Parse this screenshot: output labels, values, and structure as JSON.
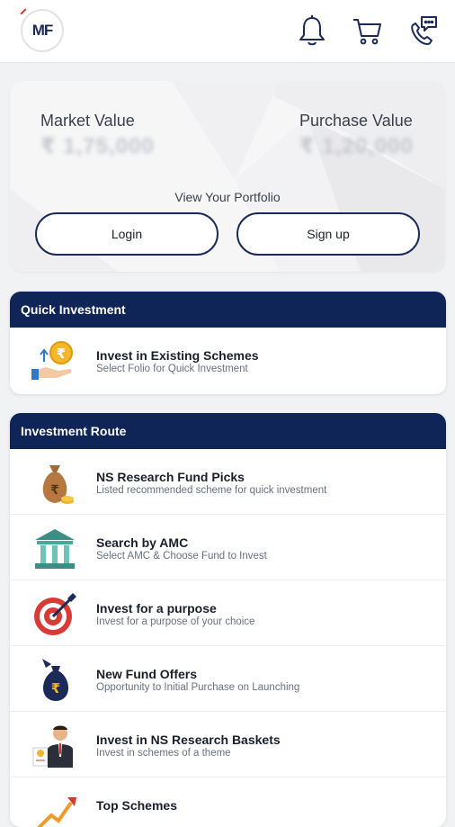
{
  "header": {
    "logo_text": "MF",
    "icons": [
      "bell-icon",
      "cart-icon",
      "phone-chat-icon"
    ]
  },
  "portfolio": {
    "market_value_label": "Market Value",
    "market_value": "₹ 1,75,000",
    "purchase_value_label": "Purchase Value",
    "purchase_value": "₹ 1,20,000",
    "view_text": "View Your Portfolio",
    "login_label": "Login",
    "signup_label": "Sign up"
  },
  "quick_investment": {
    "title": "Quick Investment",
    "items": [
      {
        "title": "Invest in Existing Schemes",
        "subtitle": "Select Folio for Quick Investment",
        "icon": "hand-coin-icon"
      }
    ]
  },
  "investment_route": {
    "title": "Investment Route",
    "items": [
      {
        "title": "NS Research Fund Picks",
        "subtitle": "Listed recommended scheme for quick investment",
        "icon": "money-bag-icon"
      },
      {
        "title": "Search by AMC",
        "subtitle": "Select AMC & Choose Fund to Invest",
        "icon": "bank-building-icon"
      },
      {
        "title": "Invest for a purpose",
        "subtitle": "Invest for a purpose of your choice",
        "icon": "target-icon"
      },
      {
        "title": "New Fund Offers",
        "subtitle": "Opportunity to Initial Purchase on Launching",
        "icon": "rupee-bag-icon"
      },
      {
        "title": "Invest in NS Research Baskets",
        "subtitle": "Invest in schemes of a theme",
        "icon": "businessman-icon"
      },
      {
        "title": "Top Schemes",
        "subtitle": "",
        "icon": "chart-up-icon"
      }
    ]
  },
  "colors": {
    "primary": "#0f2457",
    "accent": "#d33a2c",
    "background": "#f1f2f4"
  }
}
